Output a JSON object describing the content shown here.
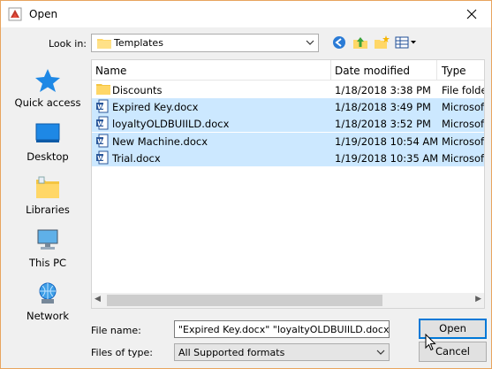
{
  "window": {
    "title": "Open"
  },
  "toolbar": {
    "look_in_label": "Look in:",
    "look_in_value": "Templates"
  },
  "places": [
    {
      "label": "Quick access",
      "icon": "star-icon"
    },
    {
      "label": "Desktop",
      "icon": "desktop-icon"
    },
    {
      "label": "Libraries",
      "icon": "libraries-icon"
    },
    {
      "label": "This PC",
      "icon": "computer-icon"
    },
    {
      "label": "Network",
      "icon": "network-icon"
    }
  ],
  "columns": {
    "name": "Name",
    "date": "Date modified",
    "type": "Type"
  },
  "files": [
    {
      "name": "Discounts",
      "date": "1/18/2018 3:38 PM",
      "type": "File folder",
      "icon": "folder-icon",
      "selected": false
    },
    {
      "name": "Expired Key.docx",
      "date": "1/18/2018 3:49 PM",
      "type": "Microsoft",
      "icon": "word-doc-icon",
      "selected": true
    },
    {
      "name": "loyaltyOLDBUIILD.docx",
      "date": "1/18/2018 3:52 PM",
      "type": "Microsoft",
      "icon": "word-doc-icon",
      "selected": true
    },
    {
      "name": "New Machine.docx",
      "date": "1/19/2018 10:54 AM",
      "type": "Microsoft",
      "icon": "word-doc-icon",
      "selected": true
    },
    {
      "name": "Trial.docx",
      "date": "1/19/2018 10:35 AM",
      "type": "Microsoft",
      "icon": "word-doc-icon",
      "selected": true
    }
  ],
  "form": {
    "file_name_label": "File name:",
    "file_name_value": "\"Expired Key.docx\" \"loyaltyOLDBUIILD.docx\" \"",
    "files_of_type_label": "Files of type:",
    "files_of_type_value": "All Supported formats"
  },
  "buttons": {
    "open": "Open",
    "cancel": "Cancel"
  },
  "colors": {
    "selection": "#cce8ff",
    "accent": "#0078d7",
    "window_border": "#e8a45e"
  }
}
